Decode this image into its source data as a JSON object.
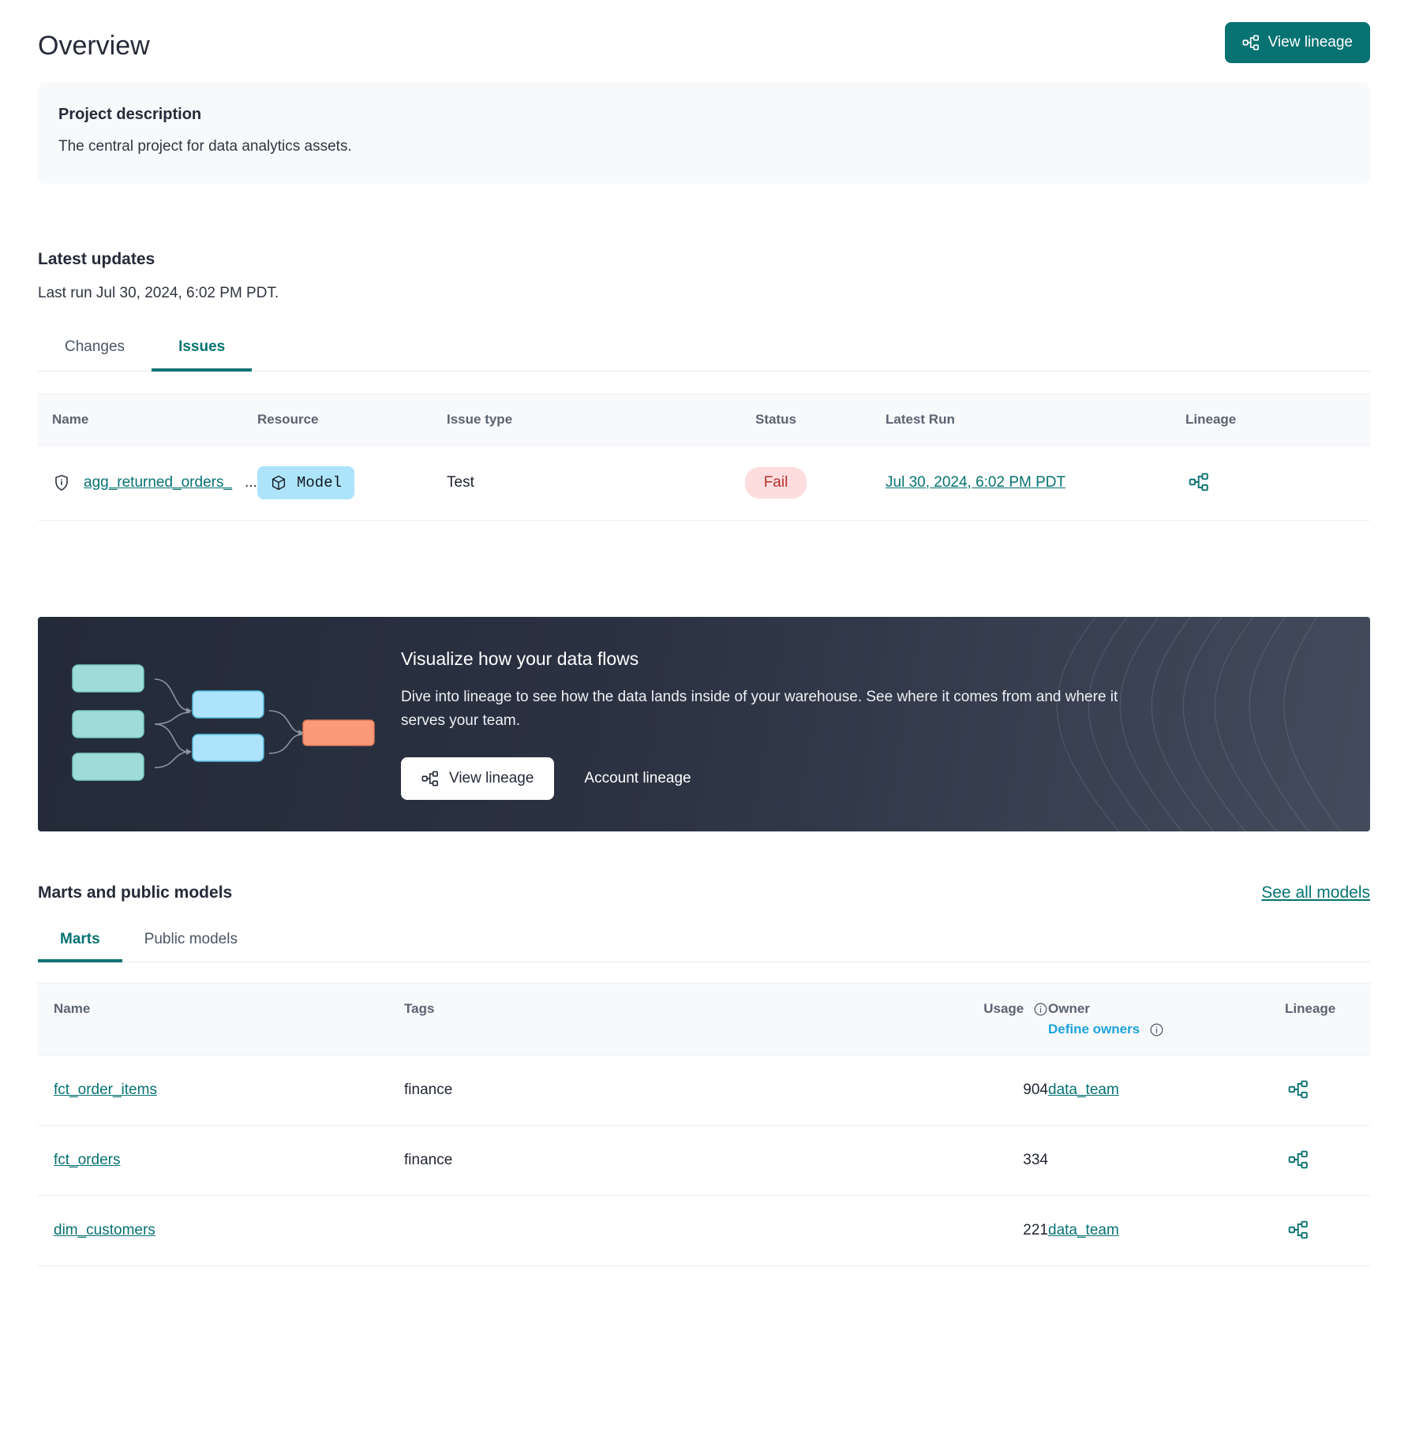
{
  "header": {
    "title": "Overview",
    "view_lineage_label": "View lineage"
  },
  "project_description": {
    "title": "Project description",
    "body": "The central project for data analytics assets."
  },
  "latest_updates": {
    "title": "Latest updates",
    "last_run_text": "Last run Jul 30, 2024, 6:02 PM PDT.",
    "tabs": [
      {
        "label": "Changes",
        "active": false
      },
      {
        "label": "Issues",
        "active": true
      }
    ],
    "columns": [
      "Name",
      "Resource",
      "Issue type",
      "Status",
      "Latest Run",
      "Lineage"
    ],
    "rows": [
      {
        "name": "agg_returned_orders_",
        "name_suffix": "...",
        "resource": "Model",
        "issue_type": "Test",
        "status": "Fail",
        "latest_run": "Jul 30, 2024, 6:02 PM PDT"
      }
    ]
  },
  "banner": {
    "title": "Visualize how your data flows",
    "text": "Dive into lineage to see how the data lands inside of your warehouse. See where it comes from and where it serves your team.",
    "primary_label": "View lineage",
    "secondary_label": "Account lineage"
  },
  "marts": {
    "title": "Marts and public models",
    "see_all_label": "See all models",
    "tabs": [
      {
        "label": "Marts",
        "active": true
      },
      {
        "label": "Public models",
        "active": false
      }
    ],
    "columns": {
      "name": "Name",
      "tags": "Tags",
      "usage": "Usage",
      "owner": "Owner",
      "define_owners": "Define owners",
      "lineage": "Lineage"
    },
    "rows": [
      {
        "name": "fct_order_items",
        "tags": "finance",
        "usage": "904",
        "owner": "data_team"
      },
      {
        "name": "fct_orders",
        "tags": "finance",
        "usage": "334",
        "owner": ""
      },
      {
        "name": "dim_customers",
        "tags": "",
        "usage": "221",
        "owner": "data_team"
      }
    ]
  },
  "colors": {
    "accent_teal": "#077272",
    "link_blue": "#1aa3dd",
    "badge_model_bg": "#ade4fc",
    "badge_fail_bg": "#fdddde",
    "badge_fail_text": "#b5312a",
    "banner_bg": "#2b3242",
    "illustration_source": "#9fdcd8",
    "illustration_mid": "#ade4fc",
    "illustration_target": "#fb9a79"
  },
  "icons": {
    "lineage": "lineage-icon",
    "shield_info": "shield-info-icon",
    "cube": "cube-icon",
    "info": "info-icon"
  }
}
